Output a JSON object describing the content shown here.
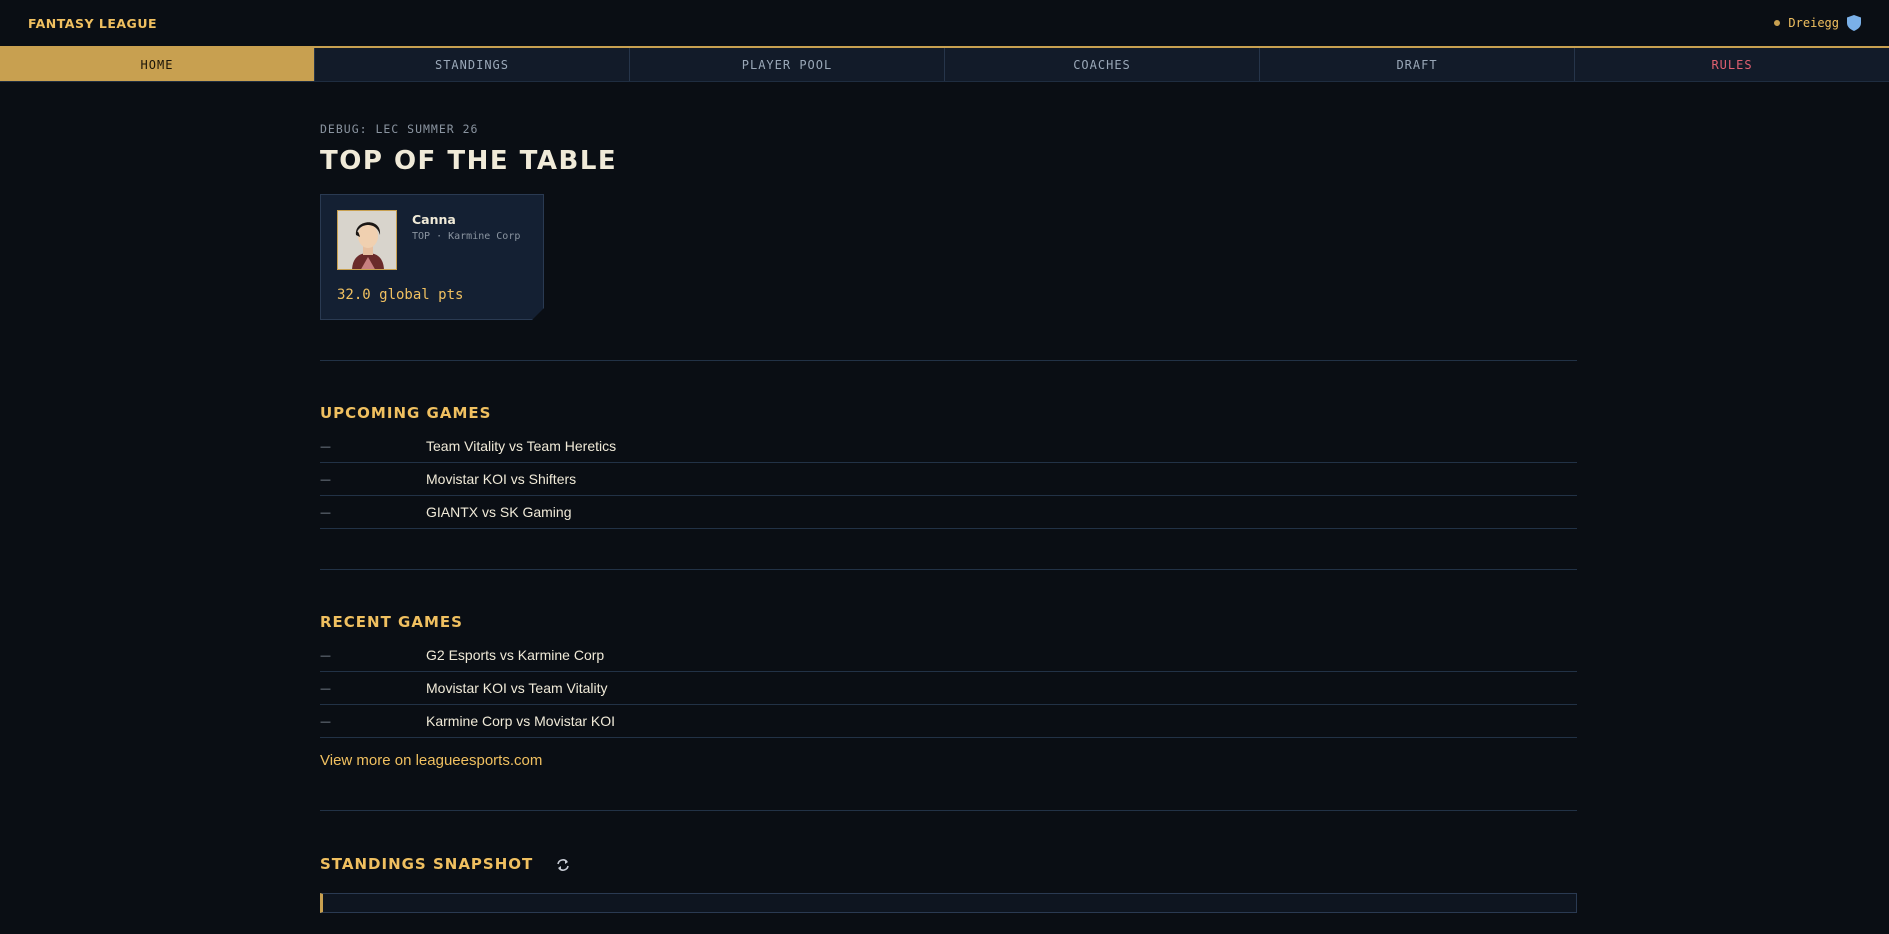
{
  "header": {
    "brand": "FANTASY LEAGUE",
    "username": "Dreiegg",
    "shield_icon": "shield-icon"
  },
  "nav": {
    "items": [
      {
        "label": "HOME"
      },
      {
        "label": "STANDINGS"
      },
      {
        "label": "PLAYER POOL"
      },
      {
        "label": "COACHES"
      },
      {
        "label": "DRAFT"
      },
      {
        "label": "RULES"
      }
    ],
    "active": "HOME"
  },
  "main": {
    "debug": "DEBUG: LEC SUMMER 26",
    "title": "TOP OF THE TABLE",
    "top_player": {
      "name": "Canna",
      "meta": "TOP · Karmine Corp",
      "points": "32.0 global pts"
    },
    "upcoming": {
      "title": "UPCOMING GAMES",
      "games": [
        {
          "time": "—",
          "match": "Team Vitality vs Team Heretics"
        },
        {
          "time": "—",
          "match": "Movistar KOI vs Shifters"
        },
        {
          "time": "—",
          "match": "GIANTX vs SK Gaming"
        }
      ]
    },
    "recent": {
      "title": "RECENT GAMES",
      "games": [
        {
          "time": "—",
          "match": "G2 Esports vs Karmine Corp"
        },
        {
          "time": "—",
          "match": "Movistar KOI vs Team Vitality"
        },
        {
          "time": "—",
          "match": "Karmine Corp vs Movistar KOI"
        }
      ],
      "view_more": "View more on leagueesports.com"
    },
    "standings": {
      "title": "STANDINGS SNAPSHOT"
    }
  },
  "colors": {
    "accent": "#c8a050",
    "gold_text": "#f0c060",
    "rules": "#e06070",
    "background": "#0a0e14"
  }
}
